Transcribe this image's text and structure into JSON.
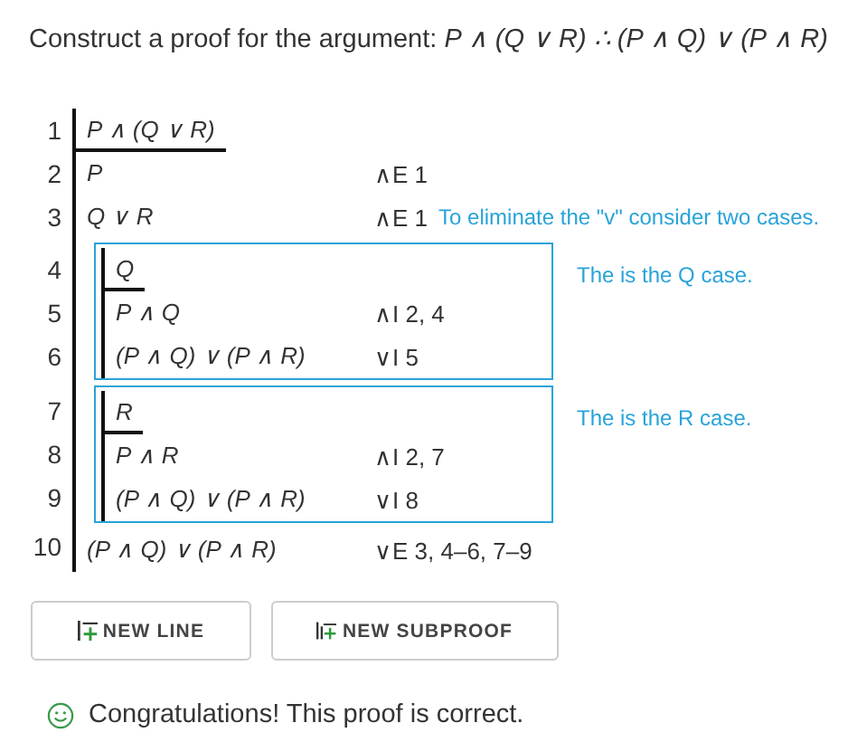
{
  "prompt": "Construct a proof for the argument: *P ∧ (Q ∨ R) ∴ (P ∧ Q) ∨ (P ∧ R)*",
  "proof": [
    {
      "kind": "line",
      "number": "1",
      "formula": "P ∧ (Q ∨ R)",
      "assumption": true
    },
    {
      "kind": "line",
      "number": "2",
      "formula": "P",
      "rule": "∧E 1",
      "assumption": false
    },
    {
      "kind": "line",
      "number": "3",
      "formula": "Q ∨ R",
      "rule": "∧E 1",
      "assumption": false,
      "comment": "To eliminate the \"v\" consider two cases."
    },
    {
      "kind": "subproof",
      "comment": "The is the Q case.",
      "lines": [
        {
          "number": "4",
          "formula": "Q",
          "assumption": true
        },
        {
          "number": "5",
          "formula": "P ∧ Q",
          "rule": "∧I 2, 4",
          "assumption": false
        },
        {
          "number": "6",
          "formula": "(P ∧ Q) ∨ (P ∧ R)",
          "rule": "∨I 5",
          "assumption": false
        }
      ]
    },
    {
      "kind": "subproof",
      "comment": "The is the R case.",
      "lines": [
        {
          "number": "7",
          "formula": "R",
          "assumption": true
        },
        {
          "number": "8",
          "formula": "P ∧ R",
          "rule": "∧I 2, 7",
          "assumption": false
        },
        {
          "number": "9",
          "formula": "(P ∧ Q) ∨ (P ∧ R)",
          "rule": "∨I 8",
          "assumption": false
        }
      ]
    },
    {
      "kind": "line",
      "number": "10",
      "formula": "(P ∧ Q) ∨ (P ∧ R)",
      "rule": "∨E 3, 4–6, 7–9",
      "assumption": false
    }
  ],
  "buttons": [
    {
      "kind": "new-line",
      "label": "NEW LINE"
    },
    {
      "kind": "new-subproof",
      "label": "NEW SUBPROOF"
    }
  ],
  "status": {
    "kind": "success",
    "text": "Congratulations! This proof is correct."
  }
}
